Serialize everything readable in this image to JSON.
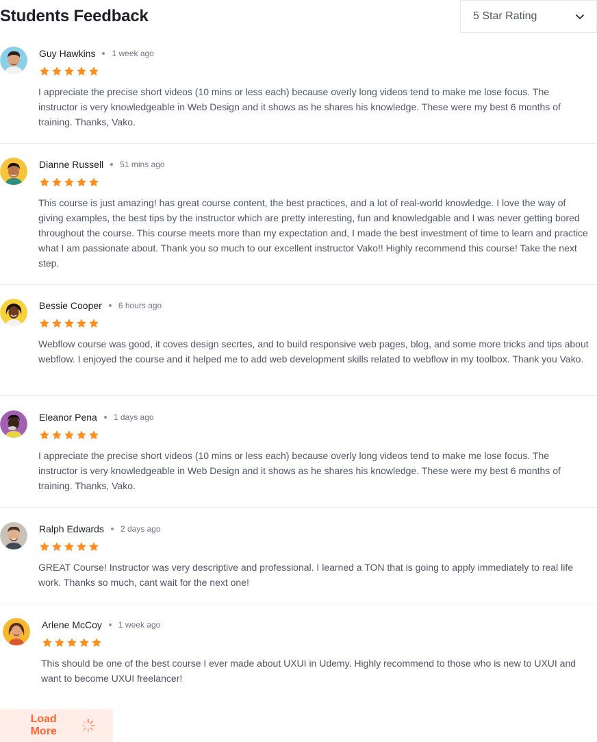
{
  "header": {
    "title": "Students Feedback",
    "rating_filter": "5 Star Rating"
  },
  "colors": {
    "star": "#fd8e1f",
    "accent": "#ff6636",
    "accent_bg": "#ffeee8"
  },
  "reviews": [
    {
      "name": "Guy Hawkins",
      "time": "1 week ago",
      "rating": 5,
      "text": "I appreciate the precise short videos (10 mins or less each) because overly long videos tend to make me lose focus. The instructor is very knowledgeable in Web Design and it shows as he shares his knowledge. These were my best 6 months of training. Thanks, Vako."
    },
    {
      "name": "Dianne Russell",
      "time": "51 mins ago",
      "rating": 5,
      "text": "This course is just amazing! has great course content, the best practices, and a lot of real-world knowledge. I love the way of giving examples, the best tips by the instructor which are pretty interesting, fun and knowledgable and I was never getting bored throughout the course. This course meets more than my expectation and, I made the best investment of time to learn and practice what I am passionate about. Thank you so much to our excellent instructor Vako!! Highly recommend this course! Take the next step."
    },
    {
      "name": "Bessie Cooper",
      "time": "6 hours ago",
      "rating": 5,
      "text": "Webflow course was good, it coves design secrtes, and to build responsive web pages, blog, and some more tricks and tips about webflow. I enjoyed the course and it helped me to add web development skills related to webflow in my toolbox. Thank you Vako."
    },
    {
      "name": "Eleanor Pena",
      "time": "1 days ago",
      "rating": 5,
      "text": "I appreciate the precise short videos (10 mins or less each) because overly long videos tend to make me lose focus. The instructor is very knowledgeable in Web Design and it shows as he shares his knowledge. These were my best 6 months of training. Thanks, Vako."
    },
    {
      "name": "Ralph Edwards",
      "time": "2 days ago",
      "rating": 5,
      "text": "GREAT Course! Instructor was very descriptive and professional. I learned a TON that is going to apply immediately to real life work. Thanks so much, cant wait for the next one!"
    },
    {
      "name": "Arlene McCoy",
      "time": "1 week ago",
      "rating": 5,
      "text": "This should be one of the best course I ever made about UXUI in Udemy. Highly recommend to those who is new to UXUI and want to become UXUI freelancer!"
    }
  ],
  "load_more": {
    "label": "Load More"
  }
}
